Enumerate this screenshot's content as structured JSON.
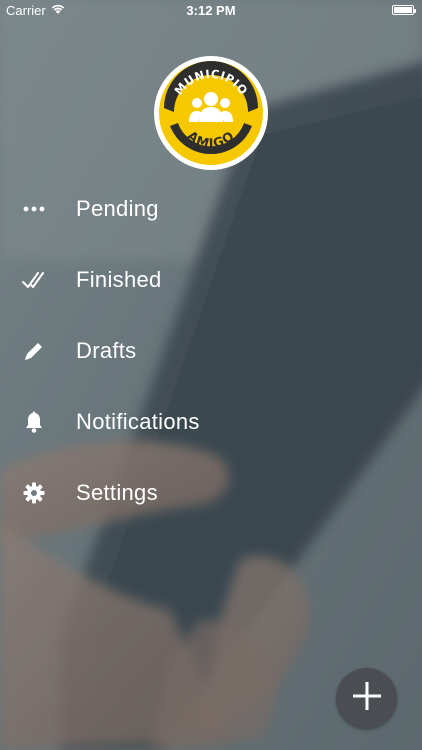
{
  "status_bar": {
    "carrier": "Carrier",
    "time": "3:12 PM"
  },
  "logo": {
    "top_text": "MUNICIPIO",
    "bottom_text": "AMIGO",
    "colors": {
      "ring": "#ffffff",
      "badge": "#f6c800",
      "band": "#2e2e2e"
    }
  },
  "menu": {
    "items": [
      {
        "label": "Pending",
        "icon": "ellipsis-icon"
      },
      {
        "label": "Finished",
        "icon": "double-check-icon"
      },
      {
        "label": "Drafts",
        "icon": "pencil-icon"
      },
      {
        "label": "Notifications",
        "icon": "bell-icon"
      },
      {
        "label": "Settings",
        "icon": "gear-icon"
      }
    ]
  },
  "fab": {
    "icon": "plus-icon",
    "color": "#4a4d52"
  }
}
